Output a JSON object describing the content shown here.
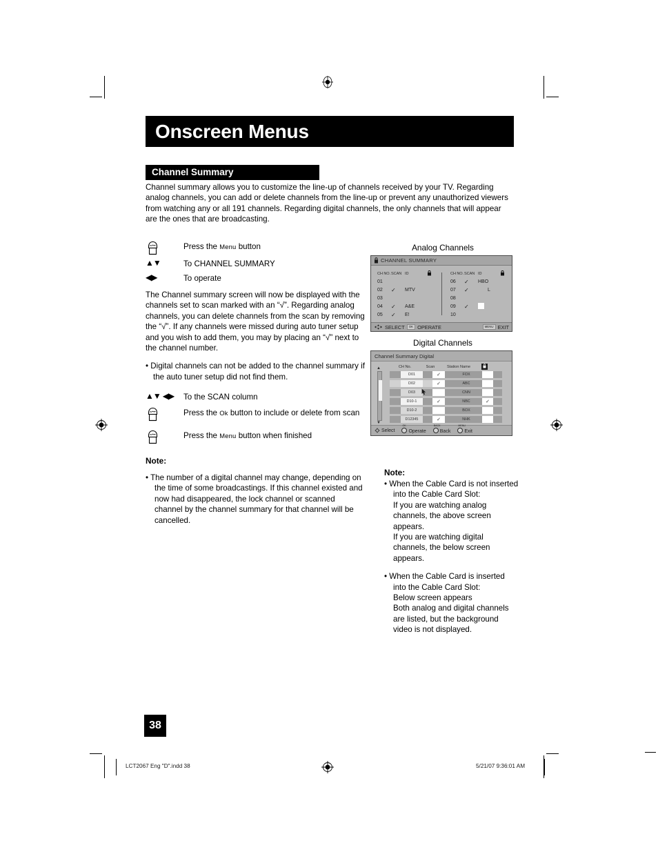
{
  "document": {
    "chapter_title": "Onscreen Menus",
    "section_title": "Channel Summary",
    "intro": "Channel summary allows you to customize the line-up of channels received by your TV. Regarding analog channels, you can add or delete channels from the line-up or prevent any unauthorized viewers from watching any or all 191 channels.  Regarding digital channels, the only channels that will appear are the ones that are broadcasting.",
    "page_number": "38",
    "footer_file": "LCT2067 Eng \"D\".indd   38",
    "footer_timestamp": "5/21/07   9:36:01 AM"
  },
  "instructions": {
    "step1_prefix": "Press the ",
    "step1_key": "Menu",
    "step1_suffix": " button",
    "step2": "To CHANNEL SUMMARY",
    "step3": "To operate",
    "paragraph": "The Channel summary screen will now be displayed with the channels set to scan marked with an “√”. Regarding analog channels, you can delete channels from the scan by removing the “√”. If any channels were missed during auto tuner setup and you wish to add them, you may by placing an “√” next to the channel number.",
    "bullet": "•  Digital channels can not be added to the channel summary if the auto tuner setup did not find them.",
    "step4": "To the SCAN column",
    "step5_prefix": "Press the ",
    "step5_key": "Ok",
    "step5_suffix": " button to include or delete from scan",
    "step6_prefix": "Press the ",
    "step6_key": "Menu",
    "step6_suffix": " button when finished"
  },
  "left_note": {
    "heading": "Note:",
    "items": [
      "•  The number of a digital channel may change, depending on the time of some broadcastings.  If this channel existed and now had disappeared, the lock channel or scanned channel by the channel summary for that channel will be cancelled."
    ]
  },
  "right_note": {
    "heading": "Note:",
    "item1": "•  When the Cable Card is not inserted into the Cable Card Slot:",
    "item1_sub1": "If you are watching analog channels, the above screen appears.",
    "item1_sub2": "If you are watching digital channels, the below screen appears.",
    "item2": "•  When the Cable Card is inserted into the Cable Card Slot:",
    "item2_sub1": "Below screen appears",
    "item2_sub2": "Both analog and digital channels are listed, but the background video is not displayed."
  },
  "analog_screen": {
    "caption": "Analog Channels",
    "title": "CHANNEL SUMMARY",
    "headers": {
      "ch_no": "CH NO.",
      "scan": "SCAN",
      "id": "ID",
      "lock": "lock-icon"
    },
    "left_rows": [
      {
        "ch_no": "01",
        "scan": "",
        "id": ""
      },
      {
        "ch_no": "02",
        "scan": "✓",
        "id": "MTV"
      },
      {
        "ch_no": "03",
        "scan": "",
        "id": ""
      },
      {
        "ch_no": "04",
        "scan": "✓",
        "id": "A&E"
      },
      {
        "ch_no": "05",
        "scan": "✓",
        "id": "E!"
      }
    ],
    "right_rows": [
      {
        "ch_no": "06",
        "scan": "✓",
        "id": "HBO"
      },
      {
        "ch_no": "07",
        "scan": "✓",
        "id": "L"
      },
      {
        "ch_no": "08",
        "scan": "",
        "id": ""
      },
      {
        "ch_no": "09",
        "scan": "✓",
        "id": "□"
      },
      {
        "ch_no": "10",
        "scan": "",
        "id": ""
      }
    ],
    "footer": {
      "select": "SELECT",
      "ok_key": "OK",
      "operate": "OPERATE",
      "menu_key": "MENU",
      "exit": "EXIT"
    }
  },
  "digital_screen": {
    "caption": "Digital Channels",
    "title": "Channel Summary Digital",
    "headers": {
      "ch_no": "CH No.",
      "scan": "Scan",
      "station": "Station Name",
      "lock": "lock-icon"
    },
    "rows": [
      {
        "ch_no": "D01",
        "scan": "✓",
        "station": "FOX",
        "lock": ""
      },
      {
        "ch_no": "D02",
        "scan": "✓",
        "station": "ABC",
        "lock": ""
      },
      {
        "ch_no": "D03",
        "scan": "",
        "station": "CNN",
        "lock": ""
      },
      {
        "ch_no": "D10-1",
        "scan": "✓",
        "station": "NBC",
        "lock": "✓"
      },
      {
        "ch_no": "D10-2",
        "scan": "",
        "station": "BOX",
        "lock": ""
      },
      {
        "ch_no": "D12345",
        "scan": "✓",
        "station": "NHK",
        "lock": ""
      }
    ],
    "footer": {
      "select": "Select",
      "ok_key": "OK",
      "operate": "Operate",
      "back_key": "BACK",
      "back": "Back",
      "menu_key": "MENU",
      "exit": "Exit"
    }
  }
}
